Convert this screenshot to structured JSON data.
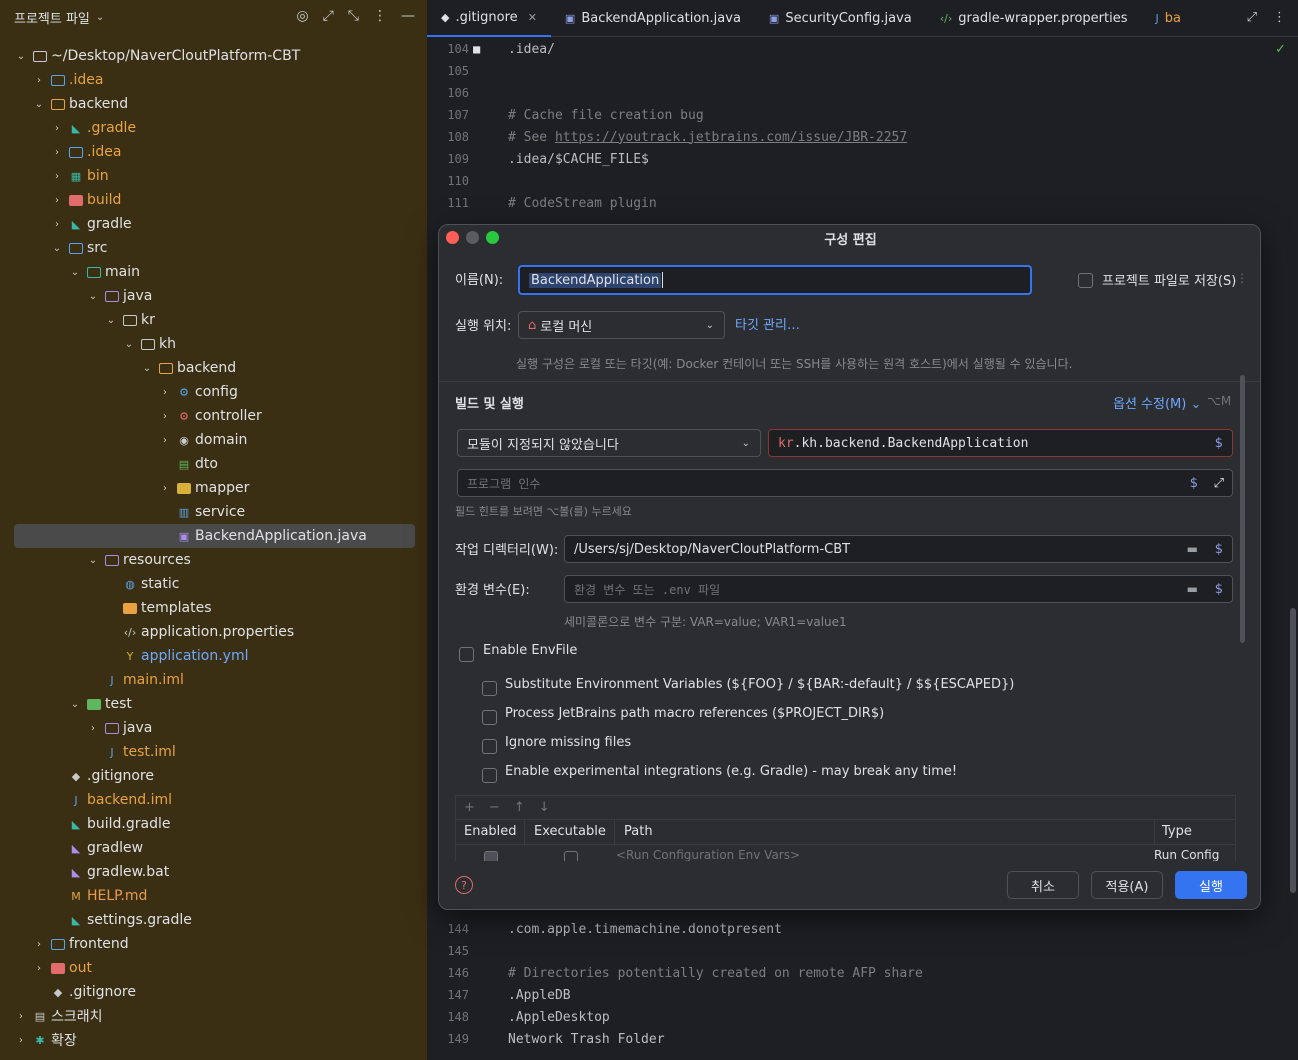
{
  "project_panel": {
    "title": "프로젝트 파일",
    "tree": [
      {
        "label": "~/Desktop/NaverCloutPlatform-CBT",
        "color": "default"
      },
      {
        "label": ".idea",
        "color": "orange"
      },
      {
        "label": "backend",
        "color": "default"
      },
      {
        "label": ".gradle",
        "color": "orange"
      },
      {
        "label": ".idea",
        "color": "orange"
      },
      {
        "label": "bin",
        "color": "orange"
      },
      {
        "label": "build",
        "color": "orange"
      },
      {
        "label": "gradle",
        "color": "default"
      },
      {
        "label": "src",
        "color": "default"
      },
      {
        "label": "main",
        "color": "default"
      },
      {
        "label": "java",
        "color": "default"
      },
      {
        "label": "kr",
        "color": "default"
      },
      {
        "label": "kh",
        "color": "default"
      },
      {
        "label": "backend",
        "color": "default"
      },
      {
        "label": "config",
        "color": "default"
      },
      {
        "label": "controller",
        "color": "default"
      },
      {
        "label": "domain",
        "color": "default"
      },
      {
        "label": "dto",
        "color": "default"
      },
      {
        "label": "mapper",
        "color": "default"
      },
      {
        "label": "service",
        "color": "default"
      },
      {
        "label": "BackendApplication.java",
        "color": "default"
      },
      {
        "label": "resources",
        "color": "default"
      },
      {
        "label": "static",
        "color": "default"
      },
      {
        "label": "templates",
        "color": "default"
      },
      {
        "label": "application.properties",
        "color": "default"
      },
      {
        "label": "application.yml",
        "color": "blue"
      },
      {
        "label": "main.iml",
        "color": "orange"
      },
      {
        "label": "test",
        "color": "default"
      },
      {
        "label": "java",
        "color": "default"
      },
      {
        "label": "test.iml",
        "color": "orange"
      },
      {
        "label": ".gitignore",
        "color": "default"
      },
      {
        "label": "backend.iml",
        "color": "orange"
      },
      {
        "label": "build.gradle",
        "color": "default"
      },
      {
        "label": "gradlew",
        "color": "default"
      },
      {
        "label": "gradlew.bat",
        "color": "default"
      },
      {
        "label": "HELP.md",
        "color": "orange"
      },
      {
        "label": "settings.gradle",
        "color": "default"
      },
      {
        "label": "frontend",
        "color": "default"
      },
      {
        "label": "out",
        "color": "orange"
      },
      {
        "label": ".gitignore",
        "color": "default"
      },
      {
        "label": "스크래치",
        "color": "default"
      },
      {
        "label": "확장",
        "color": "default"
      }
    ]
  },
  "editor": {
    "tabs": [
      ".gitignore",
      "BackendApplication.java",
      "SecurityConfig.java",
      "gradle-wrapper.properties",
      "ba"
    ],
    "code_top": [
      {
        "ln": "104",
        "text": ".idea/"
      },
      {
        "ln": "105",
        "text": ""
      },
      {
        "ln": "106",
        "text": ""
      },
      {
        "ln": "107",
        "text": "# Cache file creation bug"
      },
      {
        "ln": "108",
        "text": "# See ",
        "link": "https://youtrack.jetbrains.com/issue/JBR-2257"
      },
      {
        "ln": "109",
        "text": ".idea/$CACHE_FILE$"
      },
      {
        "ln": "110",
        "text": ""
      },
      {
        "ln": "111",
        "text": "# CodeStream plugin"
      }
    ],
    "code_bottom": [
      {
        "ln": "144",
        "text": ".com.apple.timemachine.donotpresent"
      },
      {
        "ln": "145",
        "text": ""
      },
      {
        "ln": "146",
        "text": "# Directories potentially created on remote AFP share"
      },
      {
        "ln": "147",
        "text": ".AppleDB"
      },
      {
        "ln": "148",
        "text": ".AppleDesktop"
      },
      {
        "ln": "149",
        "text": "Network Trash Folder"
      }
    ]
  },
  "dialog": {
    "title": "구성 편집",
    "name_label": "이름(N):",
    "name_value": "BackendApplication",
    "save_to_project_label": "프로젝트 파일로 저장(S)",
    "run_on_label": "실행 위치:",
    "run_on_value": "로컬 머신",
    "manage_targets": "타깃 관리…",
    "run_on_hint": "실행 구성은 로컬 또는 타깃(예: Docker 컨테이너 또는 SSH를 사용하는 원격 호스트)에서 실행될 수 있습니다.",
    "build_run_label": "빌드 및 실행",
    "modify_options": "옵션 수정(M)",
    "modify_options_shortcut": "⌥M",
    "module_value": "모듈이 지정되지 않았습니다",
    "main_class_prefix": "kr",
    "main_class_rest": ".kh.backend.BackendApplication",
    "program_args_placeholder": "프로그램 인수",
    "field_hint": "필드 힌트를 보려면 ⌥볼(를) 누르세요",
    "workdir_label": "작업 디렉터리(W):",
    "workdir_value": "/Users/sj/Desktop/NaverCloutPlatform-CBT",
    "env_label": "환경 변수(E):",
    "env_placeholder": "환경 변수 또는 .env 파일",
    "env_hint": "세미콜론으로 변수 구분: VAR=value; VAR1=value1",
    "enable_envfile": "Enable EnvFile",
    "envfile_options": [
      "Substitute Environment Variables (${FOO} / ${BAR:-default} / $${ESCAPED})",
      "Process JetBrains path macro references ($PROJECT_DIR$)",
      "Ignore missing files",
      "Enable experimental integrations (e.g. Gradle) - may break any time!"
    ],
    "table_columns": [
      "Enabled",
      "Executable",
      "Path",
      "Type"
    ],
    "table_row_path": "<Run Configuration Env Vars>",
    "table_row_type": "Run Config",
    "cancel": "취소",
    "apply": "적용(A)",
    "run": "실행"
  },
  "colors": {
    "panel_bg": "#3b2f13",
    "accent": "#3574f0",
    "dialog_bg": "#2b2d30"
  }
}
